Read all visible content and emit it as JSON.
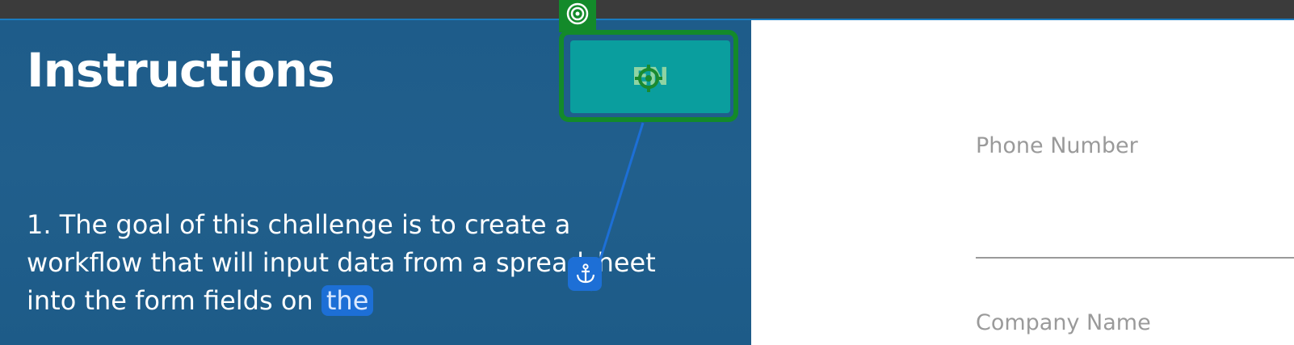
{
  "instructions": {
    "title": "Instructions",
    "step1_part1": "1. The goal of this challenge is to create a workflow that will input data from a spreadsheet into the form fields on ",
    "step1_highlight": "the"
  },
  "language_button": {
    "label": "EN"
  },
  "form": {
    "phone_label": "Phone Number",
    "phone_value": "",
    "company_label": "Company Name"
  },
  "icons": {
    "target": "target-icon",
    "crosshair": "crosshair-icon",
    "anchor": "anchor-icon"
  },
  "colors": {
    "panel_blue": "#1f5e8b",
    "highlight_green": "#138a2a",
    "button_teal": "#0a9e9e",
    "anchor_blue": "#1d6fd6"
  }
}
